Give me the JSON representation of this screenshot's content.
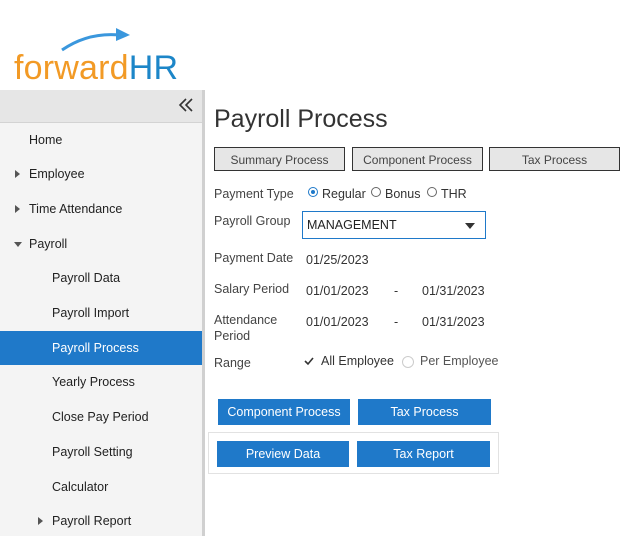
{
  "logo": {
    "part1": "forward",
    "part2": "HR"
  },
  "sidebar": {
    "items": [
      {
        "label": "Home"
      },
      {
        "label": "Employee"
      },
      {
        "label": "Time Attendance"
      },
      {
        "label": "Payroll"
      },
      {
        "label": "Payroll Data"
      },
      {
        "label": "Payroll Import"
      },
      {
        "label": "Payroll Process"
      },
      {
        "label": "Yearly Process"
      },
      {
        "label": "Close Pay Period"
      },
      {
        "label": "Payroll Setting"
      },
      {
        "label": "Calculator"
      },
      {
        "label": "Payroll Report"
      }
    ]
  },
  "main": {
    "title": "Payroll Process",
    "tabs": [
      {
        "label": "Summary Process"
      },
      {
        "label": "Component Process"
      },
      {
        "label": "Tax Process"
      }
    ],
    "payment_type": {
      "label": "Payment Type",
      "options": [
        "Regular",
        "Bonus",
        "THR"
      ],
      "selected": "Regular"
    },
    "payroll_group": {
      "label": "Payroll Group",
      "value": "MANAGEMENT"
    },
    "payment_date": {
      "label": "Payment Date",
      "value": "01/25/2023"
    },
    "salary_period": {
      "label": "Salary Period",
      "from": "01/01/2023",
      "sep": "-",
      "to": "01/31/2023"
    },
    "attendance_period": {
      "label_line1": "Attendance",
      "label_line2": "Period",
      "from": "01/01/2023",
      "sep": "-",
      "to": "01/31/2023"
    },
    "range": {
      "label": "Range",
      "options": [
        "All Employee",
        "Per Employee"
      ],
      "selected": "All Employee"
    },
    "buttons": {
      "component_process": "Component Process",
      "tax_process": "Tax Process",
      "preview_data": "Preview Data",
      "tax_report": "Tax Report"
    }
  }
}
